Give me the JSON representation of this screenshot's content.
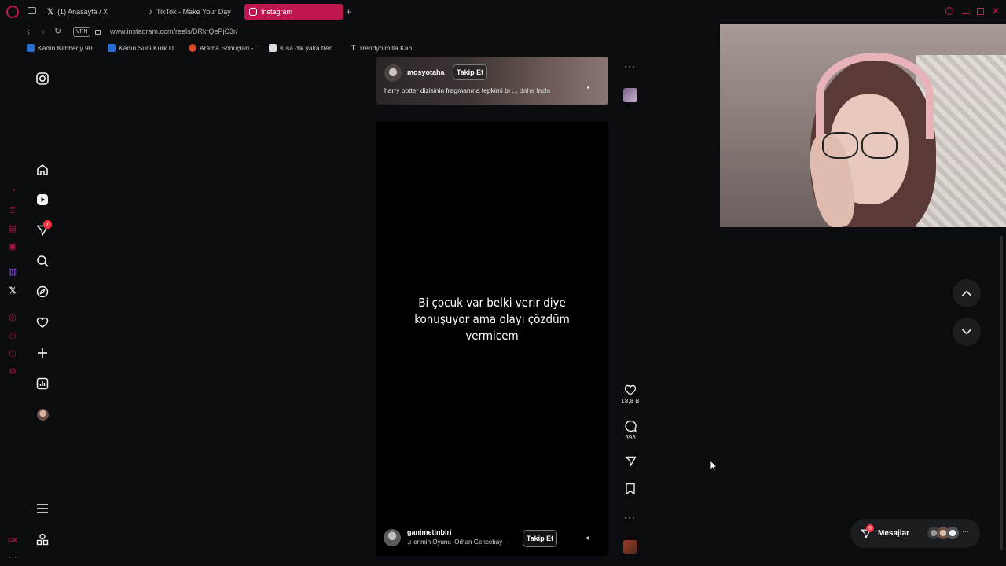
{
  "browser": {
    "tabs": [
      {
        "label": "(1) Anasayfa / X",
        "icon": "x-icon"
      },
      {
        "label": "TikTok - Make Your Day",
        "icon": "tiktok-icon"
      },
      {
        "label": "Instagram",
        "icon": "instagram-icon",
        "active": true
      }
    ],
    "url": "www.instagram.com/reels/DRkrQePjC3r/",
    "vpn_label": "VPN",
    "bookmarks": [
      {
        "label": "Kadın Kimberly 90...",
        "color": "#2a6bd1"
      },
      {
        "label": "Kadın Suni Kürk D...",
        "color": "#2a6bd1"
      },
      {
        "label": "Arama Sonuçları -...",
        "color": "#d34a2a"
      },
      {
        "label": "Kısa dik yaka tren...",
        "color": "#cccccc"
      },
      {
        "label": "Trendyolmilla Kah...",
        "color": "#cccccc"
      }
    ],
    "accent_color": "#c0164f"
  },
  "nav": {
    "notifications_badge": "7",
    "items": [
      "home-icon",
      "reels-icon",
      "messages-icon",
      "search-icon",
      "explore-icon",
      "notifications-icon",
      "create-icon",
      "dashboard-icon",
      "profile-avatar"
    ],
    "more_icon": "menu-icon",
    "apps_icon": "apps-icon"
  },
  "prev_reel": {
    "username": "mosyotaha",
    "follow_label": "Takip Et",
    "caption": "harry potter dizisinin fragmanına tepkimi bı ...",
    "more_label": "daha fazla"
  },
  "current_reel": {
    "overlay_text": "Bi çocuk var belki verir diye konuşuyor ama olayı çözdüm vermicem",
    "username": "ganimetinbiri",
    "follow_label": "Takip Et",
    "audio": "erimin Oyunu",
    "audio_artist": "Orhan Gencebay ·"
  },
  "actions": {
    "likes": "18,8 B",
    "comments": "393"
  },
  "messages_bar": {
    "label": "Mesajlar",
    "badge": "6"
  }
}
